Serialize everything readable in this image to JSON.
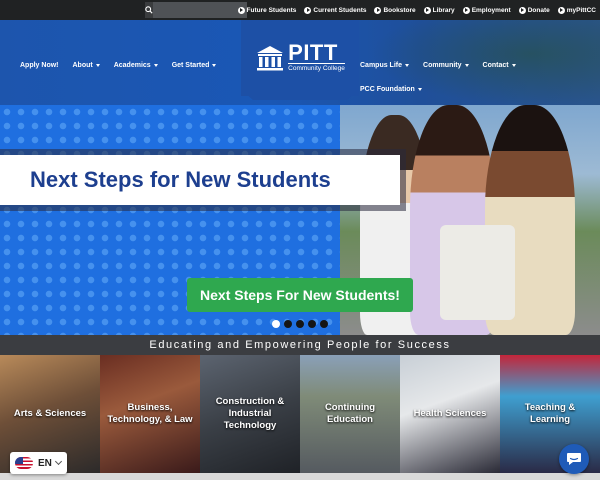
{
  "topbar": {
    "search_placeholder": "",
    "links": [
      {
        "label": "Future Students"
      },
      {
        "label": "Current Students"
      },
      {
        "label": "Bookstore"
      },
      {
        "label": "Library"
      },
      {
        "label": "Employment"
      },
      {
        "label": "Donate"
      },
      {
        "label": "myPittCC"
      }
    ]
  },
  "nav": {
    "left": [
      {
        "label": "Apply Now!",
        "dropdown": false
      },
      {
        "label": "About",
        "dropdown": true
      },
      {
        "label": "Academics",
        "dropdown": true
      },
      {
        "label": "Get Started",
        "dropdown": true
      }
    ],
    "right": [
      {
        "label": "Campus Life",
        "dropdown": true
      },
      {
        "label": "Community",
        "dropdown": true
      },
      {
        "label": "Contact",
        "dropdown": true
      }
    ],
    "right_second": [
      {
        "label": "PCC Foundation",
        "dropdown": true
      }
    ]
  },
  "logo": {
    "name": "PITT",
    "sub": "Community College"
  },
  "hero": {
    "title": "Next Steps for New Students",
    "cta_label": "Next Steps For New Students!",
    "slide_count": 5,
    "active_slide": 1
  },
  "tagline": "Educating and Empowering People for Success",
  "programs": [
    {
      "label": "Arts & Sciences"
    },
    {
      "label": "Business, Technology, & Law"
    },
    {
      "label": "Construction & Industrial Technology"
    },
    {
      "label": "Continuing Education"
    },
    {
      "label": "Health Sciences"
    },
    {
      "label": "Teaching & Learning"
    }
  ],
  "language": {
    "code": "EN"
  },
  "colors": {
    "topbar": "#202223",
    "nav_blue": "#1d55ad",
    "cta_green": "#2fa84f",
    "title_blue": "#1d3f8f"
  }
}
